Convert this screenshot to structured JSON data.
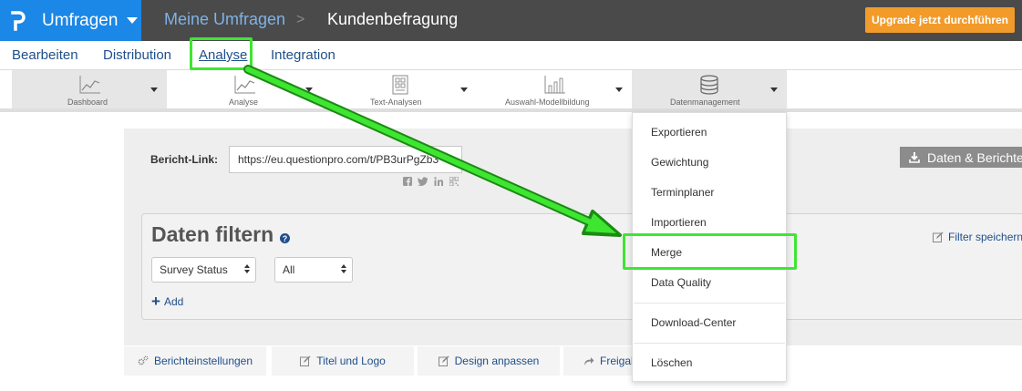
{
  "topbar": {
    "brand_label": "Umfragen",
    "breadcrumb_root": "Meine Umfragen",
    "breadcrumb_separator": ">",
    "breadcrumb_current": "Kundenbefragung",
    "upgrade_label": "Upgrade jetzt durchführen",
    "brand_color": "#1b87e6",
    "upgrade_color": "#f29b2a"
  },
  "main_nav": {
    "items": [
      {
        "label": "Bearbeiten"
      },
      {
        "label": "Distribution"
      },
      {
        "label": "Analyse"
      },
      {
        "label": "Integration"
      }
    ],
    "active": "Analyse"
  },
  "sub_nav": {
    "items": [
      {
        "label": "Dashboard",
        "icon": "line-chart-icon"
      },
      {
        "label": "Analyse",
        "icon": "line-chart-icon"
      },
      {
        "label": "Text-Analysen",
        "icon": "text-grid-icon"
      },
      {
        "label": "Auswahl-Modellbildung",
        "icon": "bar-chart-icon"
      },
      {
        "label": "Datenmanagement",
        "icon": "database-icon"
      }
    ],
    "active": "Datenmanagement"
  },
  "report": {
    "link_label": "Bericht-Link:",
    "link_value": "https://eu.questionpro.com/t/PB3urPgZb3",
    "share_icons": [
      "facebook-icon",
      "twitter-icon",
      "linkedin-icon",
      "qr-code-icon"
    ],
    "download_label": "Daten & Berichte"
  },
  "filter": {
    "title": "Daten filtern",
    "help_glyph": "?",
    "save_label": "Filter speichern",
    "selects": [
      {
        "value": "Survey Status"
      },
      {
        "value": "All"
      }
    ],
    "add_label": "Add"
  },
  "bottom_tabs": [
    {
      "label": "Berichteinstellungen",
      "icon": "gears-icon"
    },
    {
      "label": "Titel und Logo",
      "icon": "edit-icon"
    },
    {
      "label": "Design anpassen",
      "icon": "edit-icon"
    },
    {
      "label": "Freigabe",
      "icon": "share-arrow-icon"
    }
  ],
  "dropdown": {
    "items": [
      {
        "label": "Exportieren"
      },
      {
        "label": "Gewichtung"
      },
      {
        "label": "Terminplaner"
      },
      {
        "label": "Importieren"
      },
      {
        "label": "Merge"
      },
      {
        "label": "Data Quality"
      },
      {
        "label": "Download-Center"
      },
      {
        "label": "Löschen"
      }
    ],
    "highlighted": "Merge"
  },
  "annotation": {
    "highlight_color": "#3ee632"
  }
}
